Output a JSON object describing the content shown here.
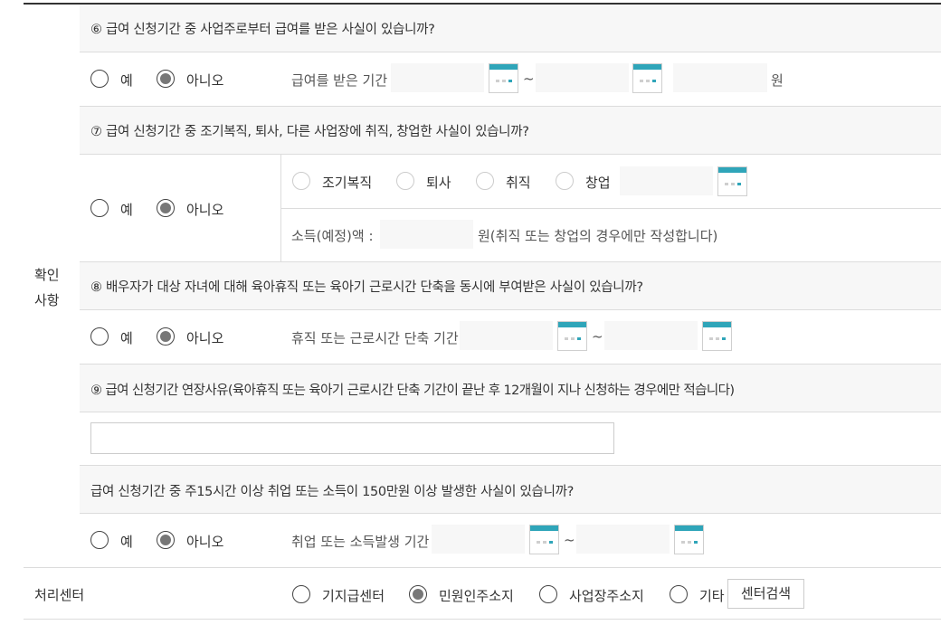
{
  "section_label_line1": "확인",
  "section_label_line2": "사항",
  "yes": "예",
  "no": "아니오",
  "q6": {
    "title": "⑥ 급여 신청기간 중 사업주로부터 급여를 받은 사실이 있습니까?",
    "period_label": "급여를 받은 기간",
    "tilde": "~",
    "unit": "원"
  },
  "q7": {
    "title": "⑦ 급여 신청기간 중 조기복직, 퇴사, 다른 사업장에 취직, 창업한 사실이 있습니까?",
    "options": [
      "조기복직",
      "퇴사",
      "취직",
      "창업"
    ],
    "income_label": "소득(예정)액 :",
    "income_note": "원(취직 또는 창업의 경우에만 작성합니다)"
  },
  "q8": {
    "title": "⑧ 배우자가 대상 자녀에 대해 육아휴직 또는 육아기 근로시간 단축을 동시에 부여받은 사실이 있습니까?",
    "period_label": "휴직 또는 근로시간 단축 기간",
    "tilde": "~"
  },
  "q9": {
    "title": "⑨ 급여 신청기간 연장사유(육아휴직 또는 육아기 근로시간 단축 기간이 끝난 후 12개월이 지나 신청하는 경우에만 적습니다)"
  },
  "q10": {
    "title": "급여 신청기간 중 주15시간 이상 취업 또는 소득이 150만원 이상 발생한 사실이 있습니까?",
    "period_label": "취업 또는 소득발생 기간",
    "tilde": "~"
  },
  "center": {
    "label": "처리센터",
    "options": [
      "기지급센터",
      "민원인주소지",
      "사업장주소지",
      "기타"
    ],
    "search_button": "센터검색"
  }
}
